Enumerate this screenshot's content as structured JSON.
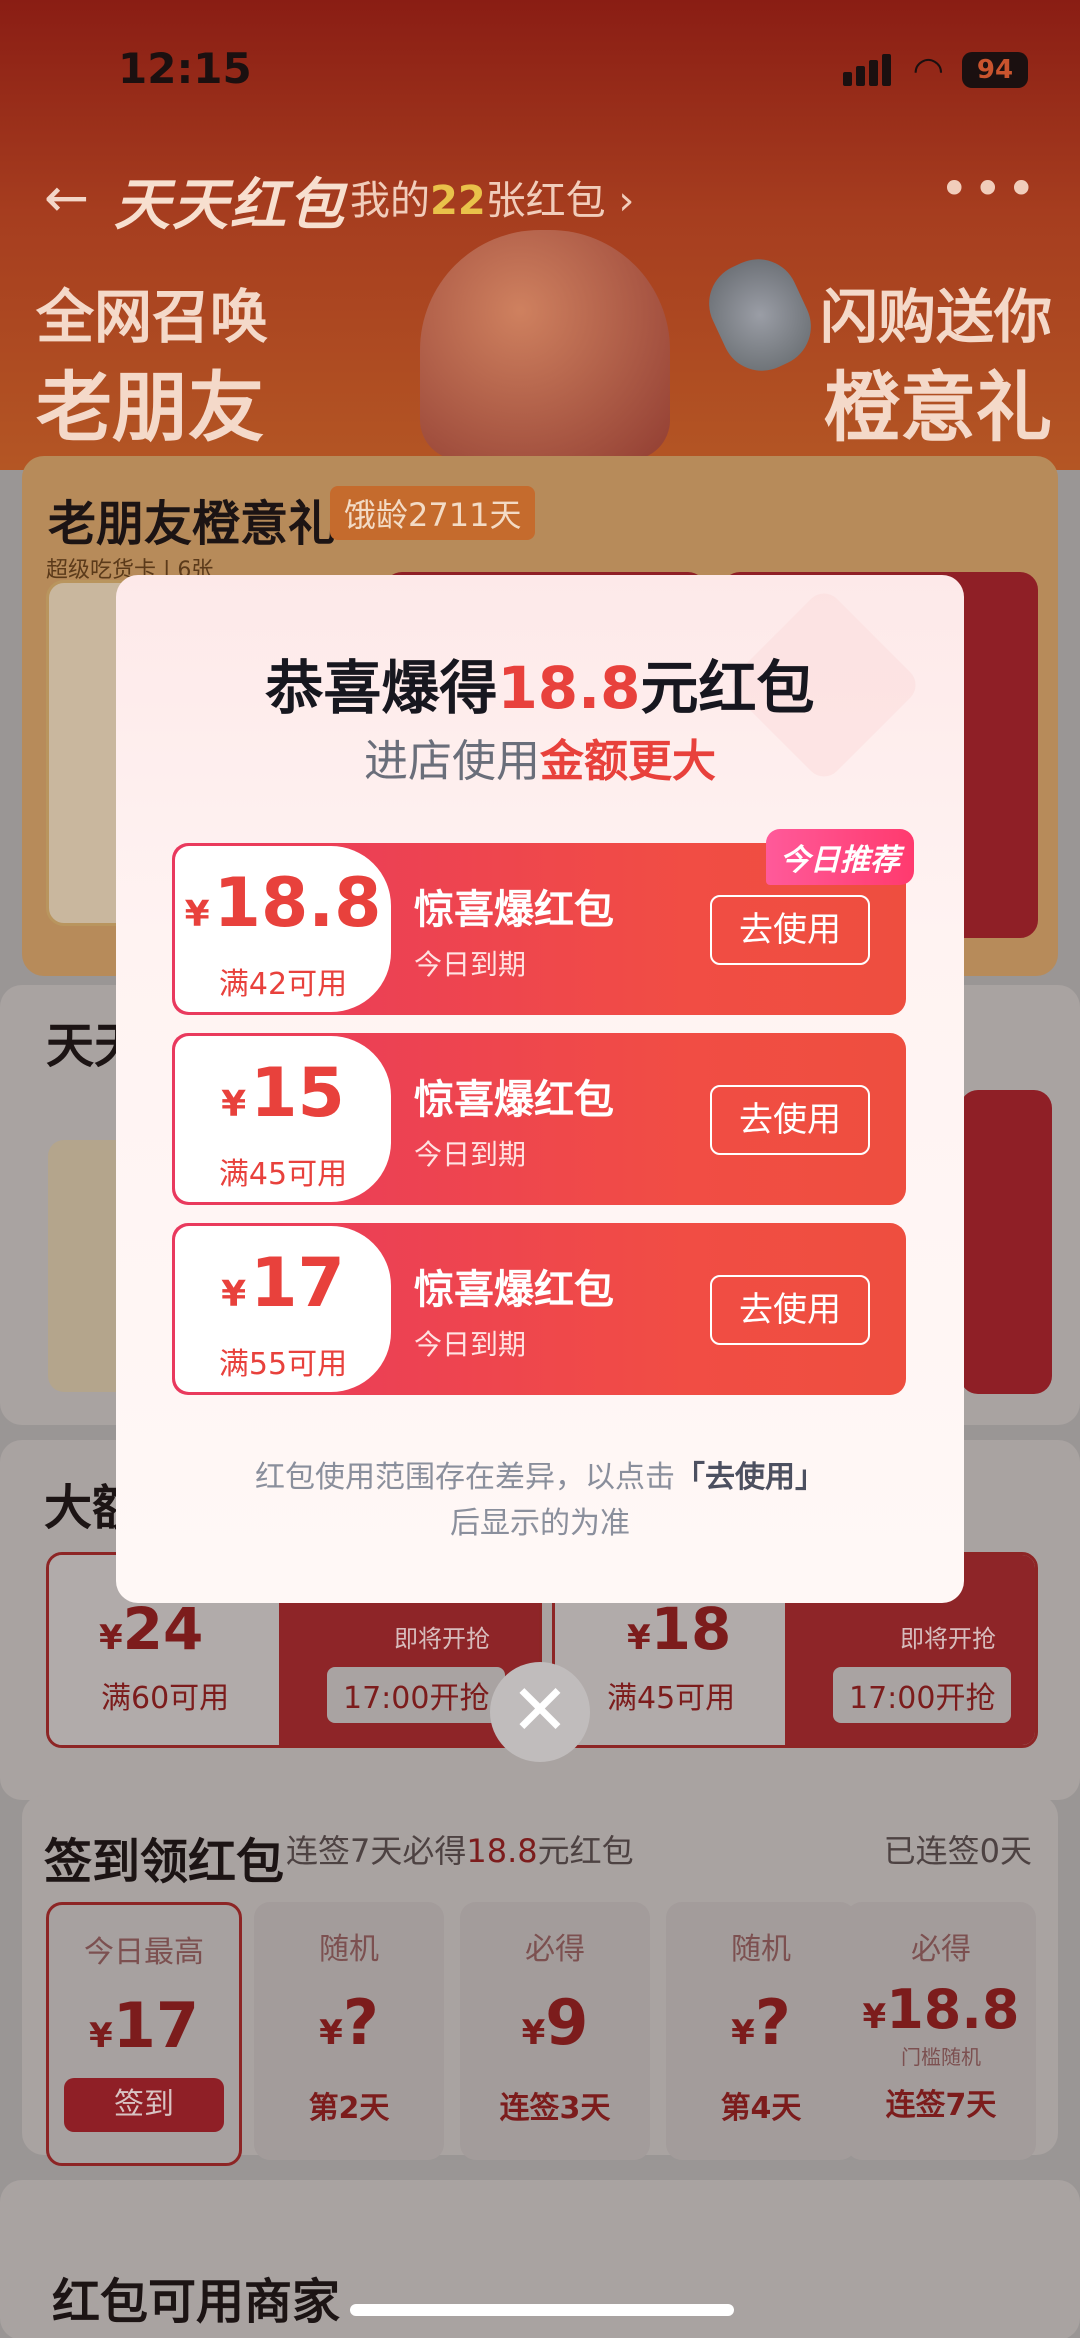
{
  "status": {
    "time": "12:15",
    "battery": "94"
  },
  "nav": {
    "back": "←",
    "title": "天天红包",
    "sub_prefix": "我的",
    "count": "22",
    "sub_suffix": "张红包 ›",
    "more": "•••"
  },
  "banner": {
    "left_line1": "全网召唤",
    "left_line2": "老朋友",
    "right_line1": "闪购送你",
    "right_line2": "橙意礼"
  },
  "section1": {
    "title": "老朋友橙意礼",
    "age_tag": "饿龄2711天",
    "vip_tag": "超级吃货卡 | 6张"
  },
  "section2": {
    "title": "天天"
  },
  "section3": {
    "title": "大额",
    "coupons": [
      {
        "amount": "24",
        "currency": "¥",
        "cond": "满60可用",
        "soon": "即将开抢",
        "btn": "17:00开抢"
      },
      {
        "amount": "18",
        "currency": "¥",
        "cond": "满45可用",
        "soon": "即将开抢",
        "btn": "17:00开抢"
      }
    ]
  },
  "signin": {
    "title": "签到领红包",
    "sub_prefix": "连签7天必得",
    "sub_amount": "18.8",
    "sub_suffix": "元红包",
    "streak": "已连签0天",
    "days": [
      {
        "top": "今日最高",
        "amount": "17",
        "label": "签到"
      },
      {
        "top": "随机",
        "amount": "?",
        "label": "第2天"
      },
      {
        "top": "必得",
        "amount": "9",
        "label": "连签3天"
      },
      {
        "top": "随机",
        "amount": "?",
        "label": "第4天"
      },
      {
        "top": "必得",
        "amount": "18.8",
        "note": "门槛随机",
        "label": "连签7天"
      }
    ]
  },
  "merchants": {
    "title": "红包可用商家"
  },
  "modal": {
    "title_prefix": "恭喜爆得",
    "title_amount": "18.8",
    "title_suffix": "元红包",
    "sub_prefix": "进店使用",
    "sub_highlight": "金额更大",
    "ribbon": "今日推荐",
    "coupons": [
      {
        "currency": "¥",
        "amount": "18.8",
        "cond": "满42可用",
        "name": "惊喜爆红包",
        "expiry": "今日到期",
        "button": "去使用"
      },
      {
        "currency": "¥",
        "amount": "15",
        "cond": "满45可用",
        "name": "惊喜爆红包",
        "expiry": "今日到期",
        "button": "去使用"
      },
      {
        "currency": "¥",
        "amount": "17",
        "cond": "满55可用",
        "name": "惊喜爆红包",
        "expiry": "今日到期",
        "button": "去使用"
      }
    ],
    "note_line1_prefix": "红包使用范围存在差异，以点击",
    "note_line1_bold": "「去使用」",
    "note_line2": "后显示的为准",
    "close": "✕"
  },
  "colors": {
    "accent": "#e8413c",
    "coupon_gradient_start": "#e9395e",
    "coupon_gradient_end": "#ee4e3f"
  }
}
